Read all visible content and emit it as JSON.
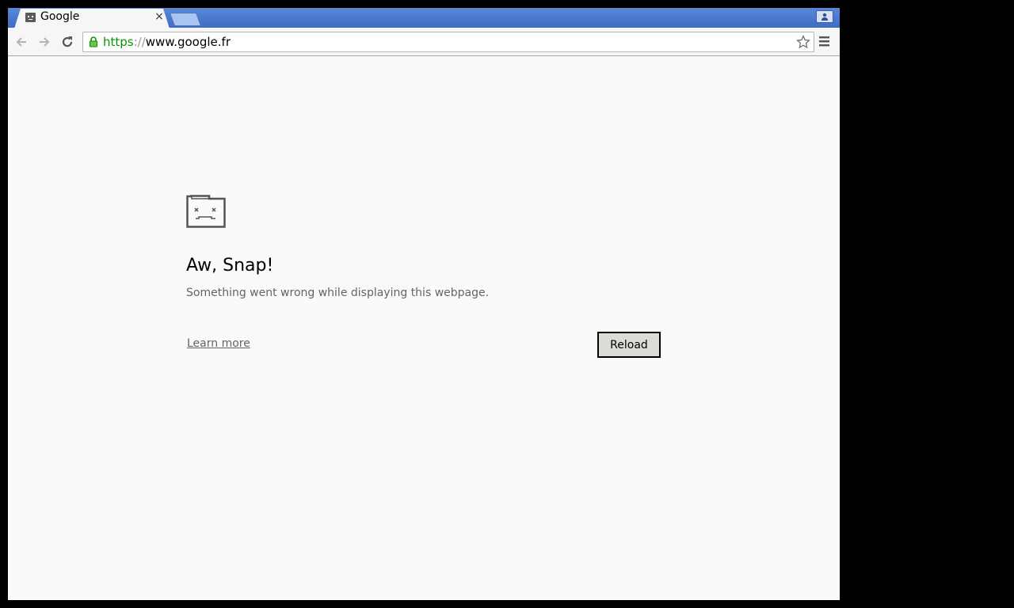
{
  "tab": {
    "title": "Google",
    "close_glyph": "×",
    "favicon": "sad-page-icon"
  },
  "toolbar": {
    "back_icon": "arrow-left-icon",
    "forward_icon": "arrow-right-icon",
    "reload_icon": "reload-icon",
    "menu_icon": "hamburger-menu-icon",
    "star_icon": "star-outline-icon"
  },
  "omnibox": {
    "scheme": "https",
    "separator": "://",
    "host": "www.google.fr",
    "secure_color": "#079500"
  },
  "error_page": {
    "icon": "sad-tab-icon",
    "heading": "Aw, Snap!",
    "message": "Something went wrong while displaying this webpage.",
    "learn_more": "Learn more",
    "reload_label": "Reload"
  },
  "colors": {
    "tabstrip": "#4a78cc",
    "page_background": "#fafafa"
  }
}
